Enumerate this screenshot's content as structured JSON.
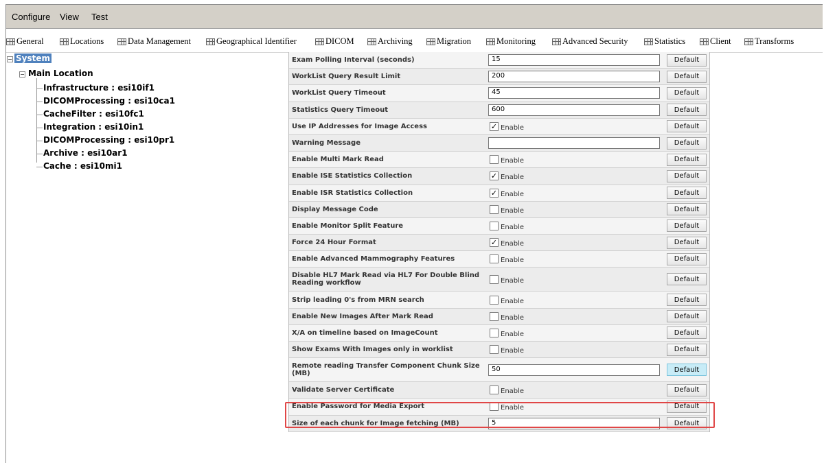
{
  "menu": [
    "Configure",
    "View",
    "Test"
  ],
  "tabs": [
    "General",
    "Locations",
    "Data Management",
    "Geographical Identifier",
    "DICOM",
    "Archiving",
    "Migration",
    "Monitoring",
    "Advanced Security",
    "Statistics",
    "Client",
    "Transforms"
  ],
  "tree": {
    "root": "System",
    "location": "Main Location",
    "children": [
      "Infrastructure : esi10if1",
      "DICOMProcessing : esi10ca1",
      "CacheFilter : esi10fc1",
      "Integration : esi10in1",
      "DICOMProcessing : esi10pr1",
      "Archive : esi10ar1",
      "Cache : esi10mi1"
    ]
  },
  "settings": [
    {
      "label": "Exam Polling Interval (seconds)",
      "type": "text",
      "value": "15"
    },
    {
      "label": "WorkList Query Result Limit",
      "type": "text",
      "value": "200"
    },
    {
      "label": "WorkList Query Timeout",
      "type": "text",
      "value": "45"
    },
    {
      "label": "Statistics Query Timeout",
      "type": "text",
      "value": "600"
    },
    {
      "label": "Use IP Addresses for Image Access",
      "type": "check",
      "checked": true
    },
    {
      "label": "Warning Message",
      "type": "text",
      "value": ""
    },
    {
      "label": "Enable Multi Mark Read",
      "type": "check",
      "checked": false
    },
    {
      "label": "Enable ISE Statistics Collection",
      "type": "check",
      "checked": true
    },
    {
      "label": "Enable ISR Statistics Collection",
      "type": "check",
      "checked": true
    },
    {
      "label": "Display Message Code",
      "type": "check",
      "checked": false
    },
    {
      "label": "Enable Monitor Split Feature",
      "type": "check",
      "checked": false
    },
    {
      "label": "Force 24 Hour Format",
      "type": "check",
      "checked": true
    },
    {
      "label": "Enable Advanced Mammography Features",
      "type": "check",
      "checked": false
    },
    {
      "label": "Disable HL7 Mark Read via HL7 For Double Blind Reading workflow",
      "type": "check",
      "checked": false,
      "tall": true
    },
    {
      "label": "Strip leading 0's from MRN search",
      "type": "check",
      "checked": false
    },
    {
      "label": "Enable New Images After Mark Read",
      "type": "check",
      "checked": false
    },
    {
      "label": "X/A on timeline based on ImageCount",
      "type": "check",
      "checked": false
    },
    {
      "label": "Show Exams With Images only in worklist",
      "type": "check",
      "checked": false
    },
    {
      "label": "Remote reading Transfer Component Chunk Size (MB)",
      "type": "text",
      "value": "50",
      "tall": true,
      "active": true
    },
    {
      "label": "Validate Server Certificate",
      "type": "check",
      "checked": false
    },
    {
      "label": "Enable Password for Media Export",
      "type": "check",
      "checked": false
    },
    {
      "label": "Size of each chunk for Image fetching (MB)",
      "type": "text",
      "value": "5"
    }
  ],
  "enable_label": "Enable",
  "default_label": "Default",
  "check_mark": "✓",
  "highlight_color": "#e04646"
}
